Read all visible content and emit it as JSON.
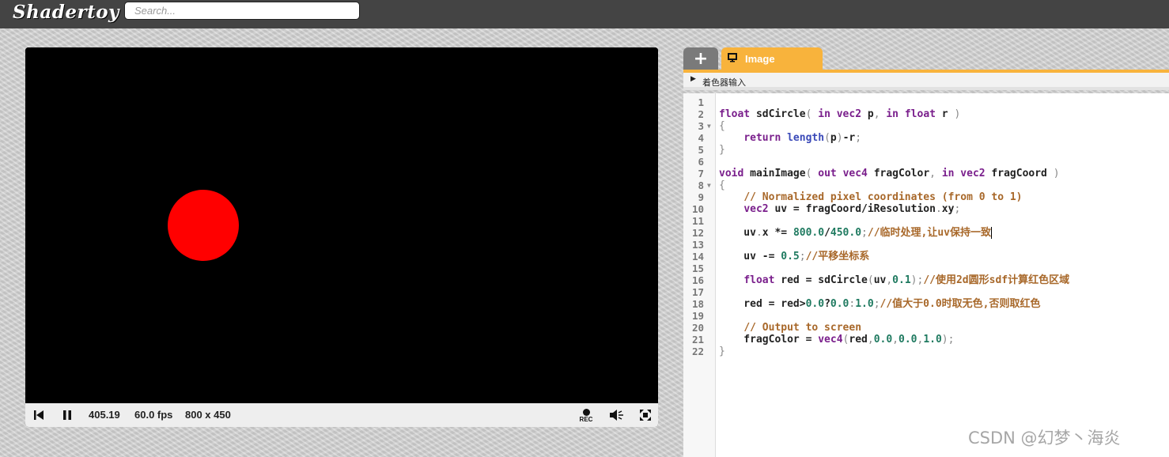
{
  "app": {
    "logo": "Shadertoy"
  },
  "search": {
    "placeholder": "Search..."
  },
  "player": {
    "time": "405.19",
    "fps": "60.0 fps",
    "resolution": "800 x 450",
    "rec_label": "REC",
    "icons": [
      "rewind-icon",
      "pause-icon",
      "record-icon",
      "volume-icon",
      "fullscreen-icon"
    ]
  },
  "editor": {
    "add_tab_label": "+",
    "active_tab_label": "Image",
    "shader_inputs_label": "着色器输入",
    "accent_color": "#f8b33c",
    "line_numbers": [
      "1",
      "2",
      "3",
      "4",
      "5",
      "6",
      "7",
      "8",
      "9",
      "10",
      "11",
      "12",
      "13",
      "14",
      "15",
      "16",
      "17",
      "18",
      "19",
      "20",
      "21",
      "22"
    ],
    "code_lines": [
      "",
      "float sdCircle( in vec2 p, in float r )",
      "{",
      "    return length(p)-r;",
      "}",
      "",
      "void mainImage( out vec4 fragColor, in vec2 fragCoord )",
      "{",
      "    // Normalized pixel coordinates (from 0 to 1)",
      "    vec2 uv = fragCoord/iResolution.xy;",
      "",
      "    uv.x *= 800.0/450.0;//临时处理,让uv保持一致",
      "",
      "    uv -= 0.5;//平移坐标系",
      "",
      "    float red = sdCircle(uv,0.1);//使用2d圆形sdf计算红色区域",
      "",
      "    red = red>0.0?0.0:1.0;//值大于0.0时取无色,否则取红色",
      "",
      "    // Output to screen",
      "    fragColor = vec4(red,0.0,0.0,1.0);",
      "}"
    ]
  },
  "watermark": "CSDN @幻梦丶海炎",
  "colors": {
    "circle": "#ff0000",
    "topbar": "#444444"
  }
}
